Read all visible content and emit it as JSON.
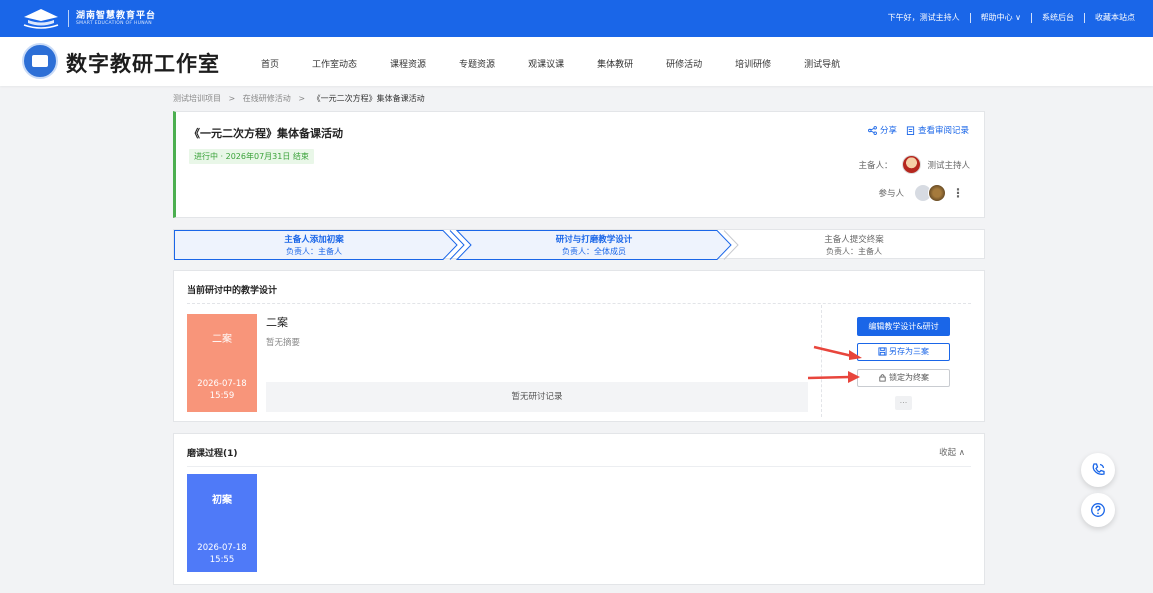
{
  "topbar": {
    "platform_name": "湖南智慧教育平台",
    "platform_sub": "SMART EDUCATION OF HUNAN",
    "greeting": "下午好，测试主持人",
    "help": "帮助中心 ∨",
    "admin": "系统后台",
    "bookmark": "收藏本站点"
  },
  "nav": {
    "studio_title": "数字教研工作室",
    "menu": [
      "首页",
      "工作室动态",
      "课程资源",
      "专题资源",
      "观课议课",
      "集体教研",
      "研修活动",
      "培训研修",
      "测试导航"
    ]
  },
  "breadcrumb": {
    "items": [
      "测试培训项目",
      "在线研修活动"
    ],
    "current": "《一元二次方程》集体备课活动",
    "sep": ">"
  },
  "activity": {
    "title": "《一元二次方程》集体备课活动",
    "status": "进行中 · 2026年07月31日 结束",
    "share": "分享",
    "view_log": "查看审阅记录",
    "host_label": "主备人：",
    "host_name": "测试主持人",
    "participants_label": "参与人"
  },
  "steps": [
    {
      "label": "主备人添加初案",
      "owner": "负责人：主备人"
    },
    {
      "label": "研讨与打磨教学设计",
      "owner": "负责人：全体成员"
    },
    {
      "label": "主备人提交终案",
      "owner": "负责人：主备人"
    }
  ],
  "current": {
    "header": "当前研讨中的教学设计",
    "thumb_title": "二案",
    "thumb_date": "2026-07-18",
    "thumb_time": "15:59",
    "name": "二案",
    "summary": "暂无摘要",
    "no_record": "暂无研讨记录",
    "btn_edit": "编辑教学设计&研讨",
    "btn_save": "另存为三案",
    "btn_lock": "锁定为终案",
    "btn_more": "..."
  },
  "process": {
    "header": "磨课过程(1)",
    "collapse": "收起 ∧",
    "thumb_title": "初案",
    "thumb_date": "2026-07-18",
    "thumb_time": "15:55"
  },
  "colors": {
    "brand_blue": "#1a66e8",
    "status_green": "#3aa23a",
    "thumb_orange": "#f8957a",
    "thumb_blue": "#4f7af8",
    "arrow_red": "#e8453c"
  },
  "icons": [
    "logo-icon",
    "share-icon",
    "log-icon",
    "save-icon",
    "lock-icon",
    "phone-icon",
    "help-icon",
    "more-vert-icon"
  ]
}
